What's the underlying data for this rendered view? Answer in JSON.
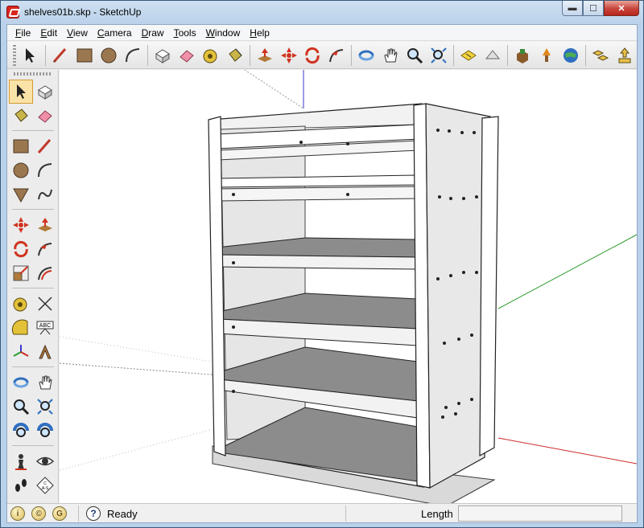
{
  "window": {
    "title": "shelves01b.skp - SketchUp",
    "minimize_label": "▬",
    "maximize_label": "☐",
    "close_label": "✕"
  },
  "menu": {
    "items": [
      {
        "label": "File",
        "accel": "F"
      },
      {
        "label": "Edit",
        "accel": "E"
      },
      {
        "label": "View",
        "accel": "V"
      },
      {
        "label": "Camera",
        "accel": "C"
      },
      {
        "label": "Draw",
        "accel": "D"
      },
      {
        "label": "Tools",
        "accel": "T"
      },
      {
        "label": "Window",
        "accel": "W"
      },
      {
        "label": "Help",
        "accel": "H"
      }
    ]
  },
  "toolbar": {
    "icons": [
      "select-icon",
      "line-icon",
      "rectangle-icon",
      "circle-icon",
      "arc-icon",
      "make-component-icon",
      "eraser-icon",
      "tape-measure-icon",
      "paint-bucket-icon",
      "push-pull-icon",
      "move-icon",
      "rotate-icon",
      "follow-me-icon",
      "orbit-icon",
      "pan-icon",
      "zoom-icon",
      "zoom-extents-icon",
      "previous-view-icon",
      "next-view-icon",
      "get-models-icon",
      "share-model-icon",
      "google-earth-icon",
      "components-icon",
      "get-photo-icon"
    ]
  },
  "lefttools": {
    "icons": [
      "select-icon",
      "make-component-icon",
      "paint-bucket-icon",
      "eraser-icon",
      "rectangle-icon",
      "line-icon",
      "circle-icon",
      "arc-icon",
      "polygon-icon",
      "freehand-icon",
      "move-icon",
      "push-pull-icon",
      "rotate-icon",
      "follow-me-icon",
      "scale-icon",
      "offset-icon",
      "tape-measure-icon",
      "dimension-icon",
      "protractor-icon",
      "text-icon",
      "axes-icon",
      "3d-text-icon",
      "orbit-icon",
      "pan-icon",
      "zoom-icon",
      "zoom-window-icon",
      "zoom-extents-icon",
      "previous-icon",
      "walk-icon",
      "look-around-icon",
      "position-camera-icon",
      "section-plane-icon"
    ],
    "dimension_text": "ABC",
    "section_text": "C\nA-S"
  },
  "statusbar": {
    "status_text": "Ready",
    "vcb_label": "Length",
    "vcb_value": "",
    "icons": [
      "geo-location-icon",
      "credits-icon",
      "sign-in-icon"
    ],
    "help_label": "?"
  },
  "colors": {
    "accent_active": "#fbe3a8",
    "shelf_gray": "#8c8c8c",
    "panel_light": "#e8e8e8",
    "axis_red": "#cc2a2a",
    "axis_green": "#2e9c2e",
    "axis_blue": "#3a3acc"
  }
}
